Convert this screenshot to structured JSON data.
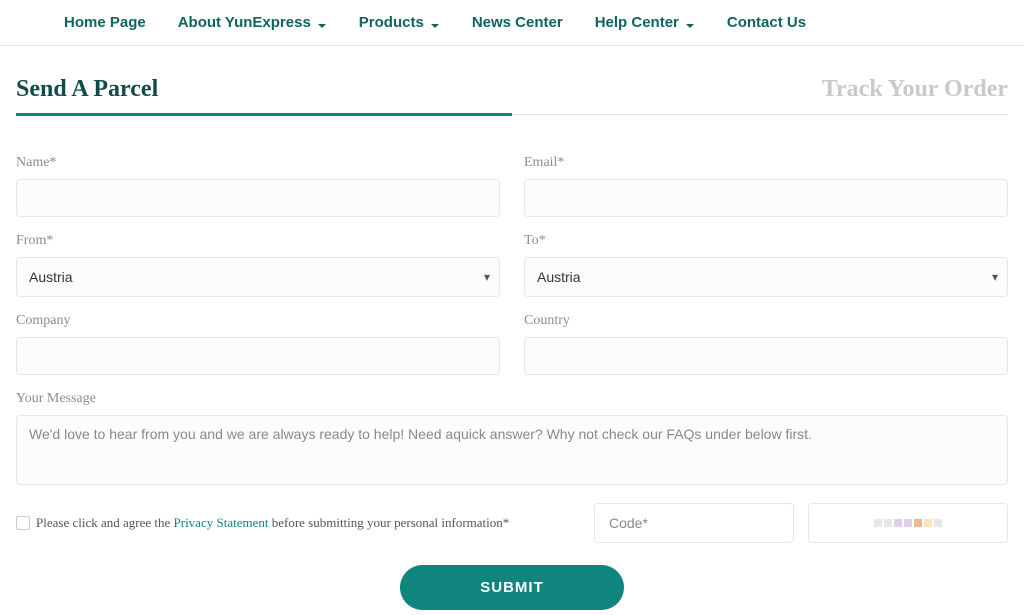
{
  "nav": {
    "home": "Home Page",
    "about": "About YunExpress",
    "products": "Products",
    "news": "News Center",
    "help": "Help Center",
    "contact": "Contact Us"
  },
  "tabs": {
    "send": "Send A Parcel",
    "track": "Track Your Order"
  },
  "form": {
    "name_label": "Name*",
    "email_label": "Email*",
    "from_label": "From*",
    "to_label": "To*",
    "from_value": "Austria",
    "to_value": "Austria",
    "company_label": "Company",
    "country_label": "Country",
    "message_label": "Your Message",
    "message_value": "We'd love to hear from you and we are always ready to help! Need aquick answer? Why not check our FAQs under below first."
  },
  "consent": {
    "pre": "Please click and agree the ",
    "link": "Privacy Statement",
    "post": " before submitting your personal information*"
  },
  "code_placeholder": "Code*",
  "submit_label": "SUBMIT"
}
